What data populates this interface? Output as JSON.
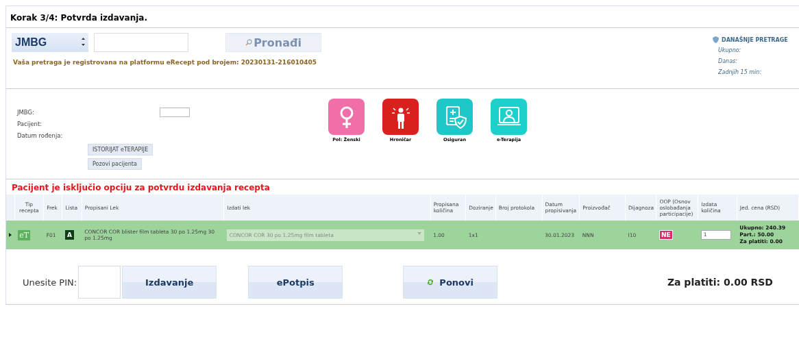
{
  "step_title": "Korak 3/4: Potvrda izdavanja.",
  "search": {
    "type_select": "JMBG",
    "button": "Pronađi",
    "message": "Vaša pretraga je registrovana na platformu eRecept pod brojem: 20230131-216010405"
  },
  "today_searches": {
    "title": "DANAŠNJE PRETRAGE",
    "items": [
      "Ukupno:",
      "Danas:",
      "Zadnjih 15 min:"
    ]
  },
  "patient": {
    "fields": [
      {
        "label": "JMBG:",
        "kind": "input"
      },
      {
        "label": "Pacijent:",
        "kind": "text"
      },
      {
        "label": "Datum rođenja:",
        "kind": "text"
      }
    ],
    "buttons": [
      "ISTORIJAT eTERAPIJE",
      "Pozovi pacijenta"
    ]
  },
  "status_icons": [
    {
      "label": "Pol: Ženski",
      "kind": "female",
      "color": "#f06fa8"
    },
    {
      "label": "Hroničar",
      "kind": "chronic",
      "color": "#d8201c"
    },
    {
      "label": "Osiguran",
      "kind": "insured",
      "color": "#1ec8c8"
    },
    {
      "label": "e-Terapija",
      "kind": "therapy",
      "color": "#1ed0cc"
    }
  ],
  "warning": "Pacijent je isključio opciju za potvrdu izdavanja recepta",
  "table": {
    "columns": [
      "",
      "Tip recepta",
      "Frek",
      "Lista",
      "Propisani Lek",
      "Izdati lek",
      "Propisana količina",
      "Doziranje",
      "Broj protokola",
      "Datum propisivanja",
      "Proizvođač",
      "Dijagnoza",
      "OOP (Osnov oslobađanja participacije)",
      "Izdata količina",
      "Jed. cena (RSD)"
    ],
    "rows": [
      {
        "selected": true,
        "tip": "eT",
        "frek": "F01",
        "lista": "A",
        "propisani": "CONCOR COR blister film tableta 30 po 1.25mg 30 po 1.25mg",
        "izdati": "CONCOR COR 30 po 1.25mg film tableta",
        "kolicina": "1.00",
        "doziranje": "1x1",
        "datum": "30.01.2023",
        "proizvodjac": "NNN",
        "dijagnoza": "I10",
        "oop": "NE",
        "izdata": "1",
        "cena": [
          "Ukupno: 240.39",
          "Part.: 50.00",
          "Za platiti: 0.00"
        ]
      }
    ]
  },
  "footer": {
    "pin_label": "Unesite PIN:",
    "buttons": [
      {
        "label": "Izdavanje",
        "kind": "plain"
      },
      {
        "label": "ePotpis",
        "kind": "plain"
      },
      {
        "label": "Ponovi",
        "kind": "refresh"
      }
    ],
    "total": "Za platiti: 0.00 RSD"
  }
}
